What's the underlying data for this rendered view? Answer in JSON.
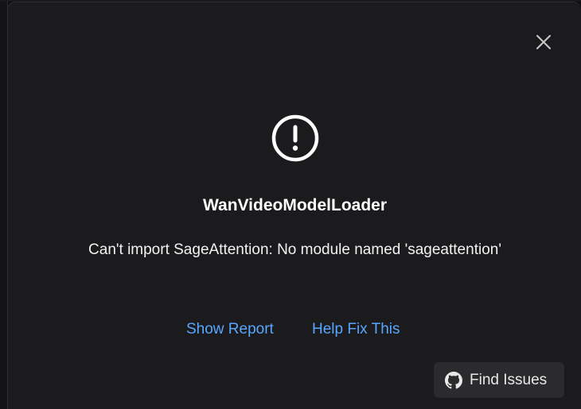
{
  "dialog": {
    "title": "WanVideoModelLoader",
    "message": "Can't import SageAttention: No module named 'sageattention'",
    "links": {
      "show_report": "Show Report",
      "help_fix": "Help Fix This"
    },
    "find_issues_label": "Find Issues",
    "icons": {
      "close": "close-icon",
      "alert": "exclamation-circle-icon",
      "github": "github-icon"
    }
  },
  "colors": {
    "dialog_bg": "#1b1b1d",
    "link": "#58a6ff",
    "button_bg": "#2b2b2e"
  }
}
